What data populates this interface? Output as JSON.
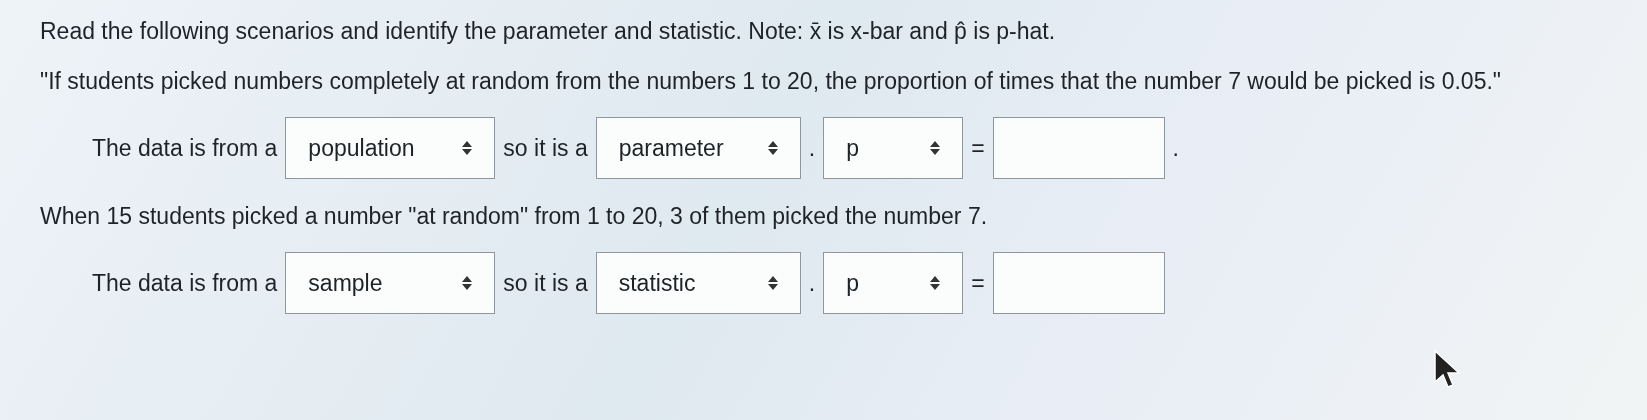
{
  "instructions": "Read the following scenarios and identify the parameter and statistic. Note: x̄ is x-bar and p̂ is p-hat.",
  "scenarios": [
    {
      "text": "\"If students picked numbers completely at random from the numbers 1 to 20, the proportion of times that the number 7 would be picked is 0.05.\"",
      "lead": "The data is from a",
      "source": "population",
      "middle": "so it is a",
      "measure": "parameter",
      "separator": ".",
      "symbol": "p",
      "equals": "=",
      "end": "."
    },
    {
      "text": "When 15 students picked a number \"at random\" from 1 to 20, 3 of them picked the number 7.",
      "lead": "The data is from a",
      "source": "sample",
      "middle": "so it is a",
      "measure": "statistic",
      "separator": ".",
      "symbol": "p",
      "equals": "="
    }
  ]
}
